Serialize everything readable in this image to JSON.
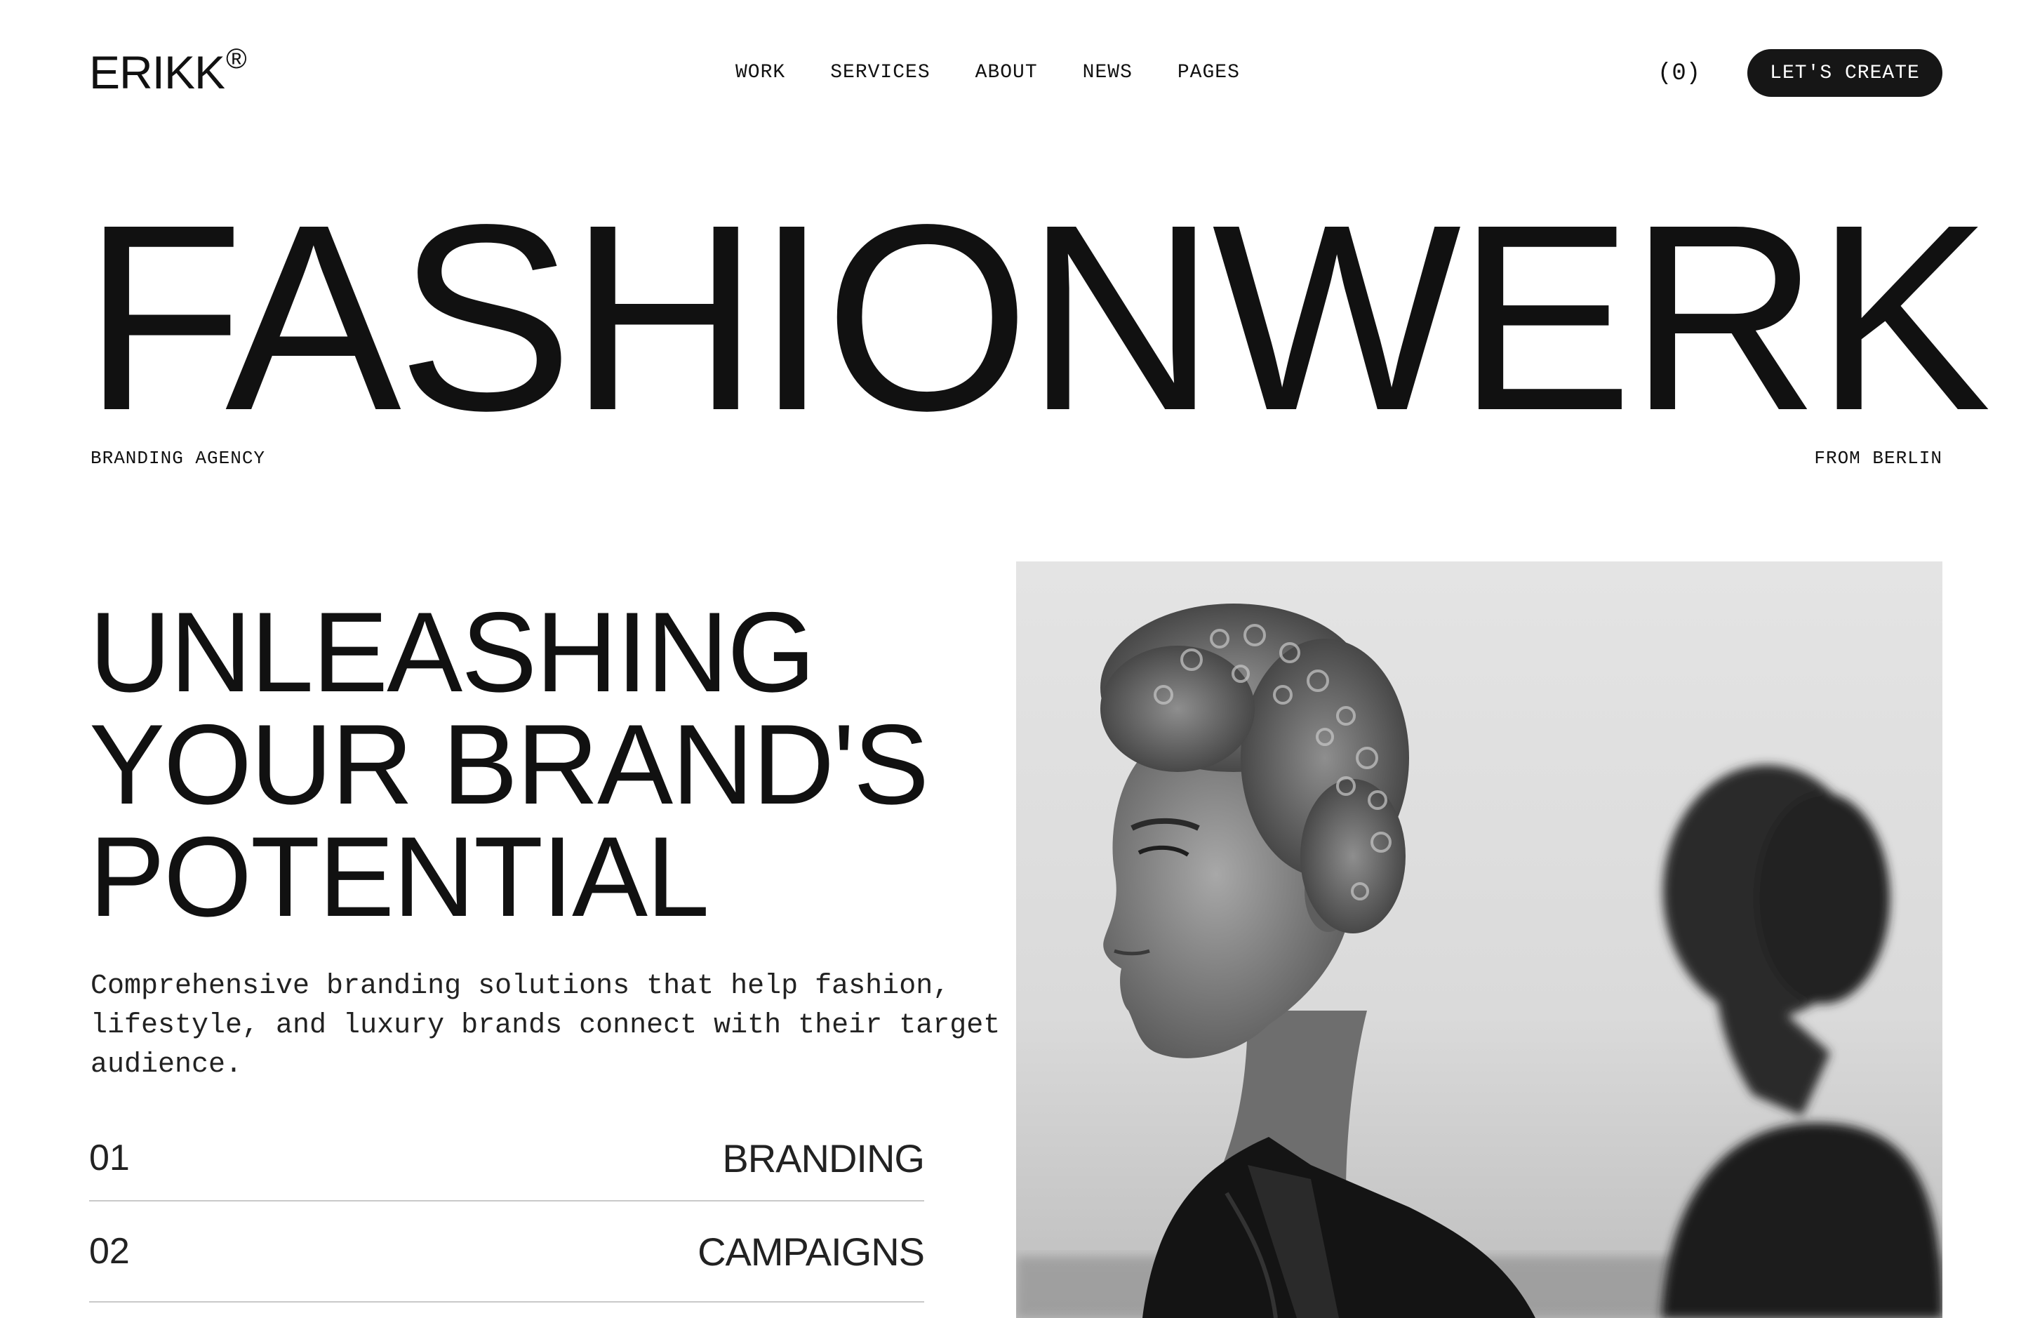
{
  "header": {
    "logo_text": "ERIKK",
    "logo_mark": "®",
    "nav": [
      "WORK",
      "SERVICES",
      "ABOUT",
      "NEWS",
      "PAGES"
    ],
    "cart_count": "(0)",
    "cta_label": "LET'S CREATE"
  },
  "hero": {
    "wordmark": "FASHIONWERK",
    "tag_left": "BRANDING AGENCY",
    "tag_right": "FROM BERLIN"
  },
  "main": {
    "headline_lines": [
      "UNLEASHING",
      "YOUR BRAND'S",
      "POTENTIAL"
    ],
    "description": "Comprehensive branding solutions that help fashion, lifestyle, and luxury brands connect with their target audience.",
    "services": [
      {
        "num": "01",
        "label": "BRANDING"
      },
      {
        "num": "02",
        "label": "CAMPAIGNS"
      }
    ]
  },
  "image": {
    "alt_semantic": "black-and-white-portrait-photo"
  },
  "colors": {
    "text": "#111111",
    "cta_bg": "#161616",
    "divider": "#c9c9c9"
  }
}
